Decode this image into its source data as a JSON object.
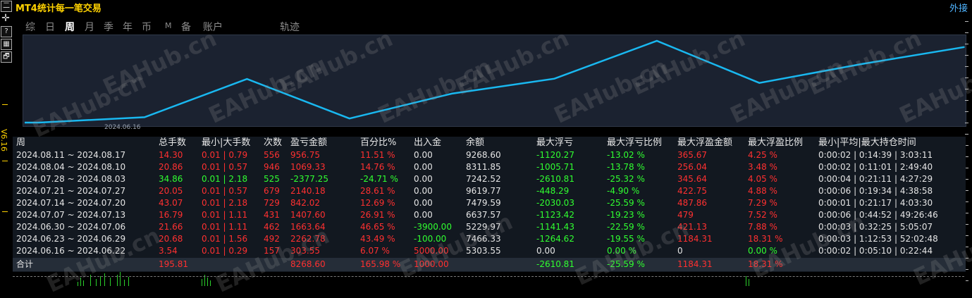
{
  "window": {
    "title": "MT4统计每一笔交易",
    "outer_label": "外接"
  },
  "sidebar": {
    "version": "V6.16",
    "buttons": [
      "二",
      "✛",
      "?",
      "▦",
      "🗗"
    ]
  },
  "tabs": [
    {
      "label": "综",
      "active": false
    },
    {
      "label": "日",
      "active": false
    },
    {
      "label": "周",
      "active": true
    },
    {
      "label": "月",
      "active": false
    },
    {
      "label": "季",
      "active": false
    },
    {
      "label": "年",
      "active": false
    },
    {
      "label": "币",
      "active": false
    },
    {
      "label": "M",
      "active": false
    },
    {
      "label": "备",
      "active": false
    },
    {
      "label": "账户",
      "active": false
    },
    {
      "label": "轨迹",
      "active": false
    }
  ],
  "chart_data": {
    "type": "line",
    "x": [
      "2024.06.16 ~ 2024.06.22",
      "2024.06.23 ~ 2024.06.29",
      "2024.06.30 ~ 2024.07.06",
      "2024.07.07 ~ 2024.07.13",
      "2024.07.14 ~ 2024.07.20",
      "2024.07.21 ~ 2024.07.27",
      "2024.07.28 ~ 2024.08.03",
      "2024.08.04 ~ 2024.08.10",
      "2024.08.11 ~ 2024.08.17"
    ],
    "series": [
      {
        "values": [
          5303.55,
          7466.33,
          5229.97,
          6637.57,
          7479.59,
          9619.77,
          7242.52,
          8311.85,
          9268.6
        ],
        "color": "#19b8f0"
      }
    ],
    "xlabel_shown": "2024.06.16",
    "grid": false
  },
  "table": {
    "headers": [
      "周",
      "总手数",
      "最小|大手数",
      "次数",
      "盈亏金额",
      "百分比%",
      "出入金",
      "余额",
      "最大浮亏",
      "最大浮亏比例",
      "最大浮盈金额",
      "最大浮盈比例",
      "最小|平均|最大持仓时间"
    ],
    "rows": [
      [
        "2024.08.11 ~ 2024.08.17",
        "14.30",
        "0.01 | 0.79",
        "556",
        "956.75",
        "11.51 %",
        "0.00",
        "9268.60",
        "-1120.27",
        "-13.02 %",
        "365.67",
        "4.25 %",
        "0:00:02 | 0:14:39 | 3:03:11"
      ],
      [
        "2024.08.04 ~ 2024.08.10",
        "20.86",
        "0.01 | 0.57",
        "946",
        "1069.33",
        "14.76 %",
        "0.00",
        "8311.85",
        "-1005.71",
        "-13.78 %",
        "256.04",
        "3.48 %",
        "0:00:02 | 0:11:01 | 2:49:40"
      ],
      [
        "2024.07.28 ~ 2024.08.03",
        "34.86",
        "0.01 | 2.18",
        "525",
        "-2377.25",
        "-24.71 %",
        "0.00",
        "7242.52",
        "-2610.81",
        "-25.32 %",
        "345.64",
        "4.05 %",
        "0:00:04 | 0:21:11 | 4:27:29"
      ],
      [
        "2024.07.21 ~ 2024.07.27",
        "20.05",
        "0.01 | 0.57",
        "679",
        "2140.18",
        "28.61 %",
        "0.00",
        "9619.77",
        "-448.29",
        "-4.90 %",
        "422.75",
        "4.88 %",
        "0:00:06 | 0:19:34 | 4:38:58"
      ],
      [
        "2024.07.14 ~ 2024.07.20",
        "43.07",
        "0.01 | 2.18",
        "729",
        "842.02",
        "12.69 %",
        "0.00",
        "7479.59",
        "-2030.03",
        "-25.59 %",
        "487.86",
        "7.29 %",
        "0:00:01 | 0:21:17 | 4:03:30"
      ],
      [
        "2024.07.07 ~ 2024.07.13",
        "16.79",
        "0.01 | 1.11",
        "431",
        "1407.60",
        "26.91 %",
        "0.00",
        "6637.57",
        "-1123.42",
        "-19.23 %",
        "479",
        "7.52 %",
        "0:00:06 | 0:44:52 | 49:26:46"
      ],
      [
        "2024.06.30 ~ 2024.07.06",
        "21.66",
        "0.01 | 1.11",
        "462",
        "1663.64",
        "46.65 %",
        "-3900.00",
        "5229.97",
        "-1141.43",
        "-22.59 %",
        "421.13",
        "7.88 %",
        "0:00:03 | 0:32:25 | 5:05:07"
      ],
      [
        "2024.06.23 ~ 2024.06.29",
        "20.68",
        "0.01 | 1.56",
        "492",
        "2262.78",
        "43.49 %",
        "-100.00",
        "7466.33",
        "-1264.62",
        "-19.55 %",
        "1184.31",
        "18.31 %",
        "0:00:03 | 1:12:53 | 52:02:48"
      ],
      [
        "2024.06.16 ~ 2024.06.22",
        "3.54",
        "0.01 | 0.29",
        "157",
        "303.55",
        "6.07 %",
        "5000.00",
        "5303.55",
        "0.00",
        "0.00 %",
        "0",
        "0.00 %",
        "0:00:02 | 0:05:10 | 0:22:44"
      ]
    ],
    "total": [
      "合计",
      "195.81",
      "",
      "",
      "8268.60",
      "165.98 %",
      "1000.00",
      "",
      "-2610.81",
      "-25.59 %",
      "1184.31",
      "18.31 %",
      ""
    ]
  },
  "colors": {
    "row_colors": [
      [
        "c-white",
        "c-red",
        "c-red",
        "c-red",
        "c-red",
        "c-red",
        "c-white",
        "c-white",
        "c-green",
        "c-green",
        "c-red",
        "c-red",
        "c-white"
      ],
      [
        "c-white",
        "c-red",
        "c-red",
        "c-red",
        "c-red",
        "c-red",
        "c-white",
        "c-white",
        "c-green",
        "c-green",
        "c-red",
        "c-red",
        "c-white"
      ],
      [
        "c-white",
        "c-green",
        "c-green",
        "c-green",
        "c-green",
        "c-green",
        "c-white",
        "c-white",
        "c-green",
        "c-green",
        "c-red",
        "c-red",
        "c-white"
      ],
      [
        "c-white",
        "c-red",
        "c-red",
        "c-red",
        "c-red",
        "c-red",
        "c-white",
        "c-white",
        "c-green",
        "c-green",
        "c-red",
        "c-red",
        "c-white"
      ],
      [
        "c-white",
        "c-red",
        "c-red",
        "c-red",
        "c-red",
        "c-red",
        "c-white",
        "c-white",
        "c-green",
        "c-green",
        "c-red",
        "c-red",
        "c-white"
      ],
      [
        "c-white",
        "c-red",
        "c-red",
        "c-red",
        "c-red",
        "c-red",
        "c-white",
        "c-white",
        "c-green",
        "c-green",
        "c-red",
        "c-red",
        "c-white"
      ],
      [
        "c-white",
        "c-red",
        "c-red",
        "c-red",
        "c-red",
        "c-red",
        "c-green",
        "c-white",
        "c-green",
        "c-green",
        "c-red",
        "c-red",
        "c-white"
      ],
      [
        "c-white",
        "c-red",
        "c-red",
        "c-red",
        "c-red",
        "c-red",
        "c-green",
        "c-white",
        "c-green",
        "c-green",
        "c-red",
        "c-red",
        "c-white"
      ],
      [
        "c-white",
        "c-red",
        "c-red",
        "c-red",
        "c-red",
        "c-red",
        "c-red",
        "c-white",
        "c-white",
        "c-green",
        "c-white",
        "c-green",
        "c-white"
      ]
    ],
    "total_colors": [
      "c-white",
      "c-red",
      "c-red",
      "c-red",
      "c-red",
      "c-red",
      "c-red",
      "c-white",
      "c-green",
      "c-green",
      "c-red",
      "c-red",
      "c-white"
    ]
  },
  "watermark": "EAHub.cn"
}
